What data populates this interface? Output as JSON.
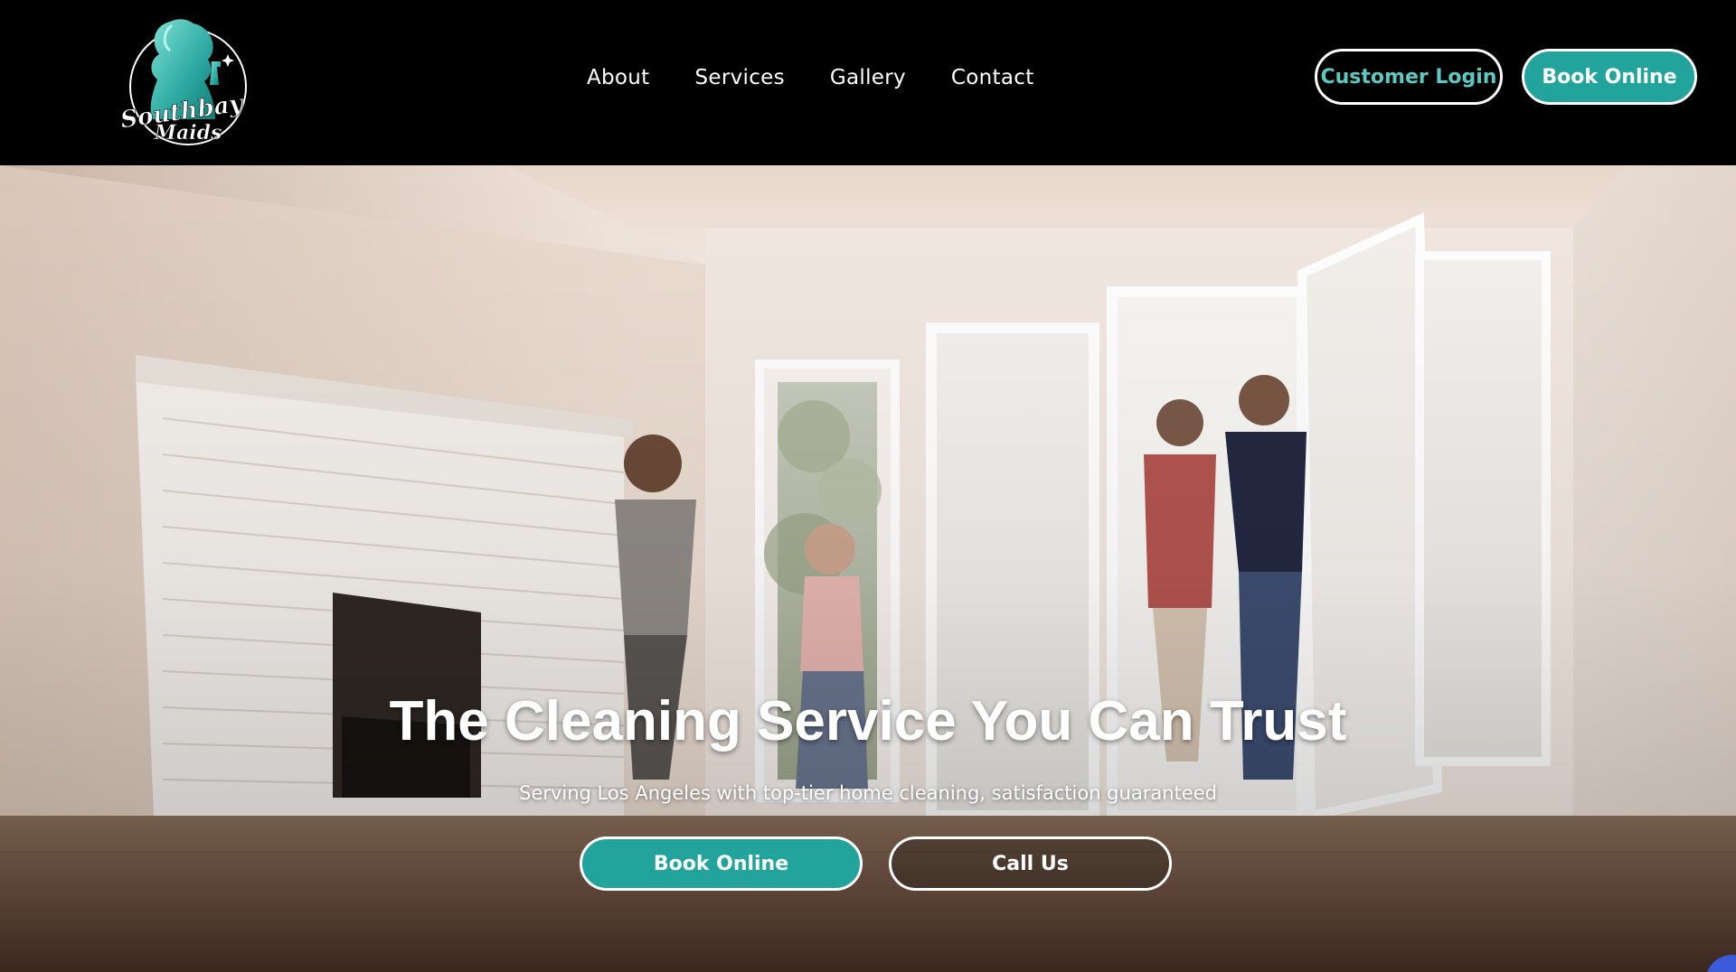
{
  "header": {
    "logo": {
      "line1": "Southbay",
      "line2": "Maids"
    },
    "nav": [
      {
        "label": "About"
      },
      {
        "label": "Services"
      },
      {
        "label": "Gallery"
      },
      {
        "label": "Contact"
      }
    ],
    "customer_login_label": "Customer Login",
    "book_online_label": "Book Online"
  },
  "hero": {
    "title": "The Cleaning Service You Can Trust",
    "subtitle": "Serving Los Angeles with top-tier home cleaning, satisfaction guaranteed",
    "book_online_label": "Book Online",
    "call_us_label": "Call Us"
  },
  "colors": {
    "accent": "#22a39b",
    "login_text": "#5ec8c0",
    "header_bg": "#000000",
    "chat_widget": "#3b5bdb"
  }
}
